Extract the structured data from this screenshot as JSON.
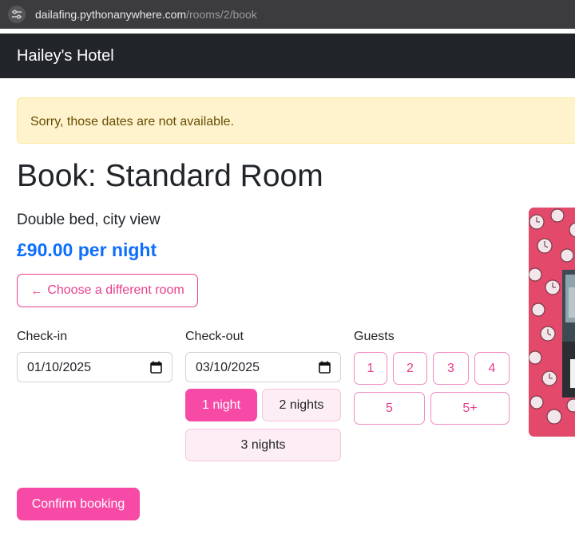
{
  "browser": {
    "url_host": "dailafing.pythonanywhere.com",
    "url_path": "/rooms/2/book",
    "site_info_icon": "tune-icon"
  },
  "navbar": {
    "brand": "Hailey's Hotel"
  },
  "alert": {
    "message": "Sorry, those dates are not available."
  },
  "room": {
    "title": "Book: Standard Room",
    "description": "Double bed, city view",
    "price": "£90.00 per night",
    "back_label": "Choose a different room",
    "back_icon": "arrow-left-icon"
  },
  "form": {
    "checkin_label": "Check-in",
    "checkin_value": "01/10/2025",
    "checkout_label": "Check-out",
    "checkout_value": "03/10/2025",
    "calendar_icon": "calendar-icon",
    "nights": [
      {
        "label": "1 night",
        "selected": true
      },
      {
        "label": "2 nights",
        "selected": false
      },
      {
        "label": "3 nights",
        "selected": false
      }
    ],
    "guests_label": "Guests",
    "guests": [
      "1",
      "2",
      "3",
      "4",
      "5",
      "5+"
    ],
    "confirm_label": "Confirm booking"
  },
  "colors": {
    "accent_pink": "#f74aa6",
    "outline_pink": "#e83e8c",
    "price_blue": "#0d6efd",
    "alert_bg": "#fff3cd",
    "alert_text": "#664d03",
    "navbar_bg": "#212529"
  }
}
